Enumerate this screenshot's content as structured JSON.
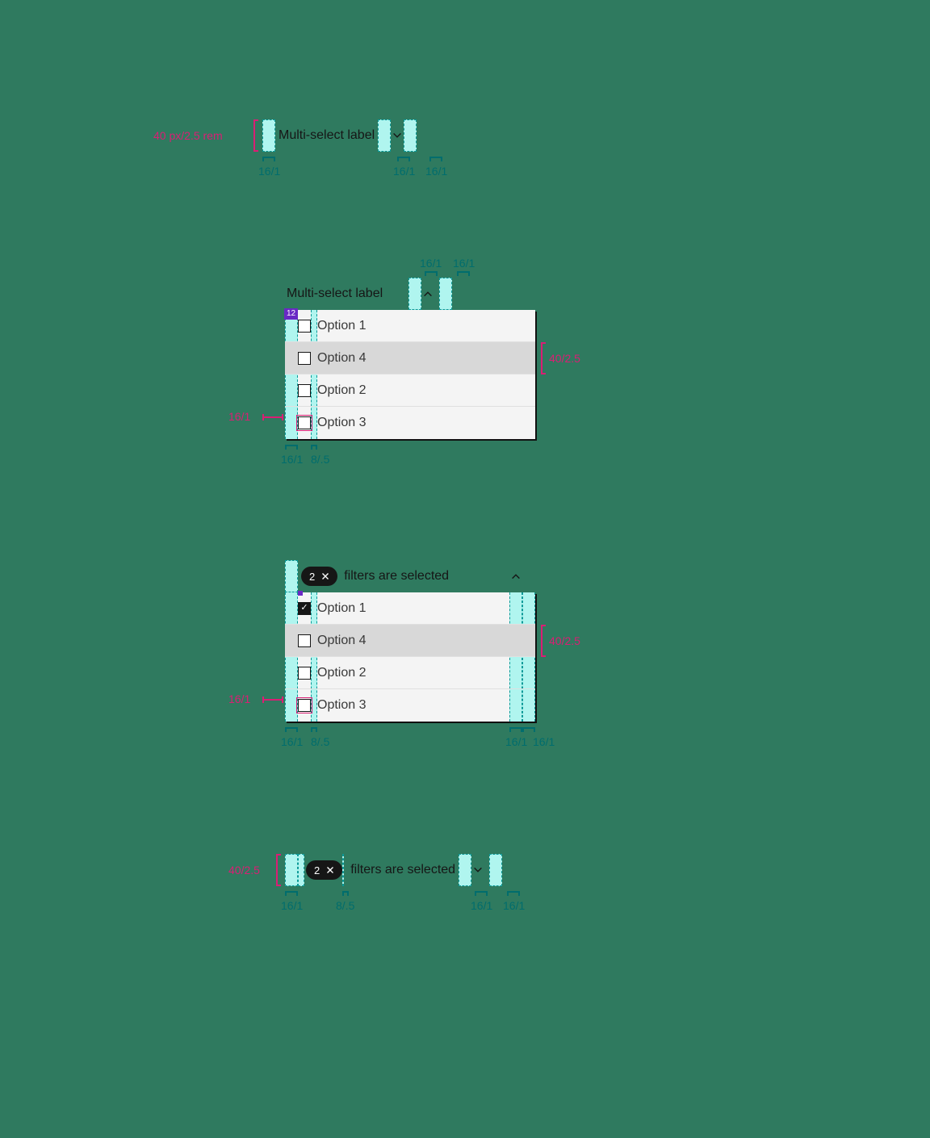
{
  "common": {
    "label": "Multi-select label",
    "options": [
      "Option 1",
      "Option 4",
      "Option 2",
      "Option 3"
    ],
    "filters_text": "filters are selected",
    "tag_count": "2"
  },
  "example1": {
    "dim_height": "40 px/2.5 rem",
    "dim_16_1": "16/1"
  },
  "example2": {
    "badge": "12",
    "dim_top_a": "16/1",
    "dim_top_b": "16/1",
    "dim_row_h": "40/2.5",
    "dim_cb": "16/1",
    "dim_pad_l": "16/1",
    "dim_gap": "8/.5"
  },
  "example3": {
    "dim_row_h": "40/2.5",
    "dim_cb": "16/1",
    "dim_pad_l": "16/1",
    "dim_gap": "8/.5",
    "dim_r1": "16/1",
    "dim_r2": "16/1"
  },
  "example4": {
    "dim_height": "40/2.5",
    "dim_l": "16/1",
    "dim_gap": "8/.5",
    "dim_r1": "16/1",
    "dim_r2": "16/1"
  }
}
